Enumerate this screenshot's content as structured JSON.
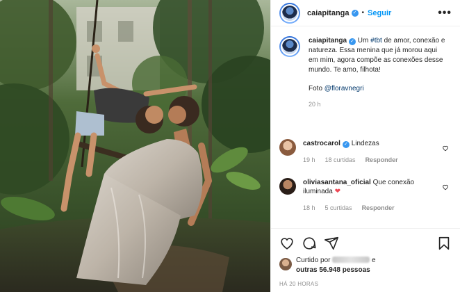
{
  "header": {
    "username": "caiapitanga",
    "verified_symbol": "✓",
    "separator": "•",
    "follow_label": "Seguir",
    "more_label": "•••"
  },
  "caption": {
    "username": "caiapitanga",
    "text_before_tag": " Um ",
    "hashtag": "#tbt",
    "text_after_tag": " de amor, conexão e natureza. Essa menina que já morou aqui em mim, agora compõe as conexões desse mundo. Te amo, filhota!",
    "credit_prefix": "Foto ",
    "credit_mention": "@floravnegri",
    "time": "20 h"
  },
  "comments": [
    {
      "username": "castrocarol",
      "text": "Lindezas",
      "time": "19 h",
      "likes": "18 curtidas",
      "reply_label": "Responder"
    },
    {
      "username": "oliviasantana_oficial",
      "text": "Que conexão iluminada",
      "emoji": "❤",
      "time": "18 h",
      "likes": "5 curtidas",
      "reply_label": "Responder"
    }
  ],
  "likes": {
    "prefix": "Curtido por",
    "connector": "e",
    "others": "outras 56.948 pessoas"
  },
  "posted_ago": "HÁ 20 HORAS",
  "colors": {
    "link_blue": "#0095f6",
    "verified_blue": "#3897f0",
    "muted": "#8e8e8e",
    "text": "#262626",
    "heart_red": "#ed4956"
  },
  "icons": [
    "heart-icon",
    "comment-icon",
    "share-icon",
    "bookmark-icon",
    "more-icon",
    "verified-icon"
  ]
}
